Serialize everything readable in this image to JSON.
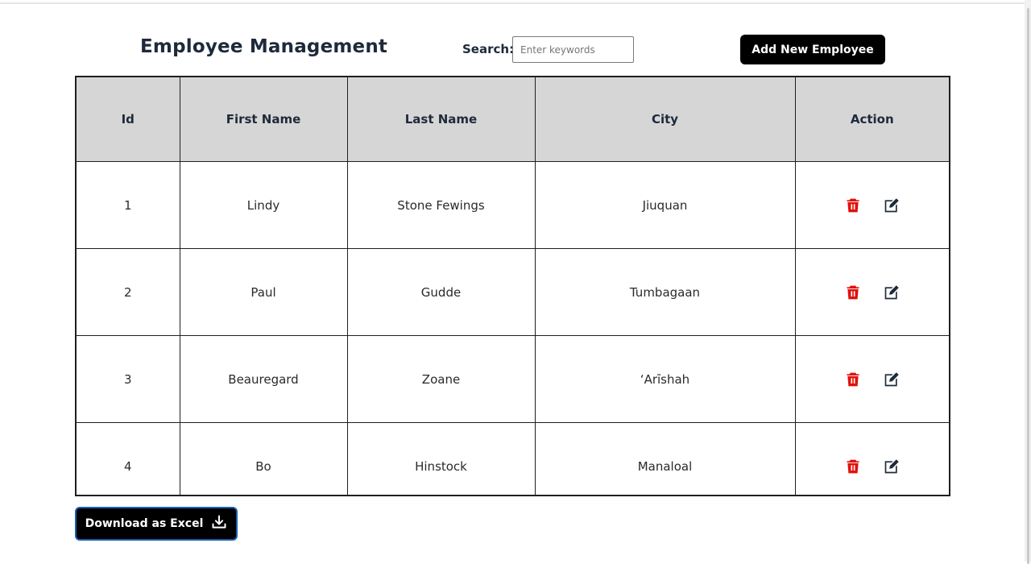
{
  "header": {
    "title": "Employee Management",
    "search_label": "Search:",
    "search_placeholder": "Enter keywords",
    "search_value": "",
    "add_button_label": "Add New Employee"
  },
  "table": {
    "columns": [
      "Id",
      "First Name",
      "Last Name",
      "City",
      "Action"
    ],
    "rows": [
      {
        "id": "1",
        "first_name": "Lindy",
        "last_name": "Stone Fewings",
        "city": "Jiuquan"
      },
      {
        "id": "2",
        "first_name": "Paul",
        "last_name": "Gudde",
        "city": "Tumbagaan"
      },
      {
        "id": "3",
        "first_name": "Beauregard",
        "last_name": "Zoane",
        "city": "‘Arīshah"
      },
      {
        "id": "4",
        "first_name": "Bo",
        "last_name": "Hinstock",
        "city": "Manaloal"
      }
    ],
    "row_actions": [
      "delete-icon",
      "edit-icon"
    ]
  },
  "footer": {
    "download_label": "Download as Excel",
    "download_icon": "download-icon"
  },
  "colors": {
    "delete_icon": "#e0110b",
    "edit_icon": "#1e2a3a",
    "header_bg": "#d6d6d6",
    "button_bg": "#000000",
    "focus_ring": "#1d5fb5"
  }
}
